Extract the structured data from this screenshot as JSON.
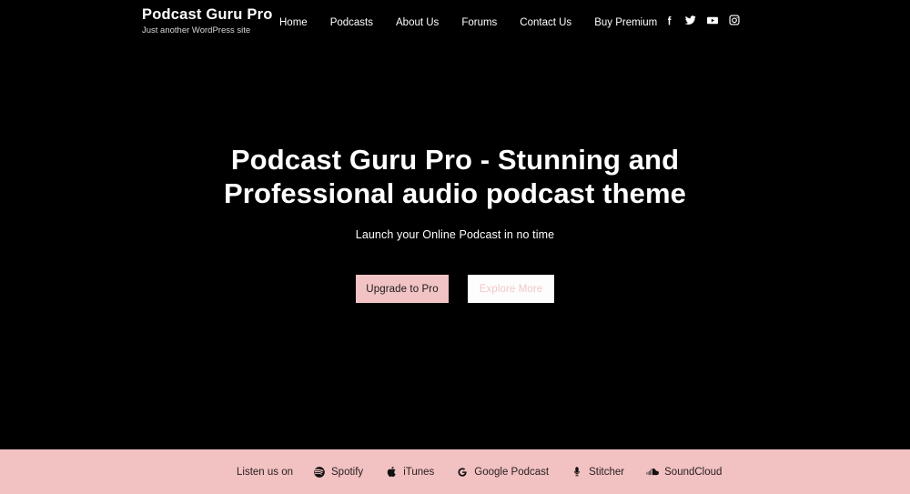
{
  "site": {
    "brand_title": "Podcast Guru Pro",
    "brand_tagline": "Just another WordPress site"
  },
  "header": {
    "nav": [
      {
        "label": "Home",
        "name": "nav-item-home"
      },
      {
        "label": "Podcasts",
        "name": "nav-item-podcasts"
      },
      {
        "label": "About Us",
        "name": "nav-item-about-us"
      },
      {
        "label": "Forums",
        "name": "nav-item-forums"
      },
      {
        "label": "Contact Us",
        "name": "nav-item-contact-us"
      },
      {
        "label": "Buy Premium",
        "name": "nav-item-buy-premium"
      }
    ],
    "social": [
      {
        "icon": "facebook-icon"
      },
      {
        "icon": "twitter-icon"
      },
      {
        "icon": "youtube-icon"
      },
      {
        "icon": "instagram-icon"
      }
    ]
  },
  "hero": {
    "title": "Podcast Guru Pro - Stunning and Professional audio podcast theme",
    "subtitle": "Launch your Online Podcast in no time",
    "primary_button": "Upgrade to Pro",
    "secondary_button": "Explore More"
  },
  "footer": {
    "label": "Listen us on",
    "platforms": [
      {
        "label": "Spotify",
        "icon": "spotify-icon"
      },
      {
        "label": "iTunes",
        "icon": "apple-icon"
      },
      {
        "label": "Google Podcast",
        "icon": "google-icon"
      },
      {
        "label": "Stitcher",
        "icon": "microphone-icon"
      },
      {
        "label": "SoundCloud",
        "icon": "soundcloud-icon"
      }
    ]
  },
  "colors": {
    "background": "#000000",
    "accent_pink": "#f2c1c1",
    "button_primary_bg": "#f2c3c4",
    "button_secondary_bg": "#fdfdfd",
    "text_light": "#ffffff"
  }
}
